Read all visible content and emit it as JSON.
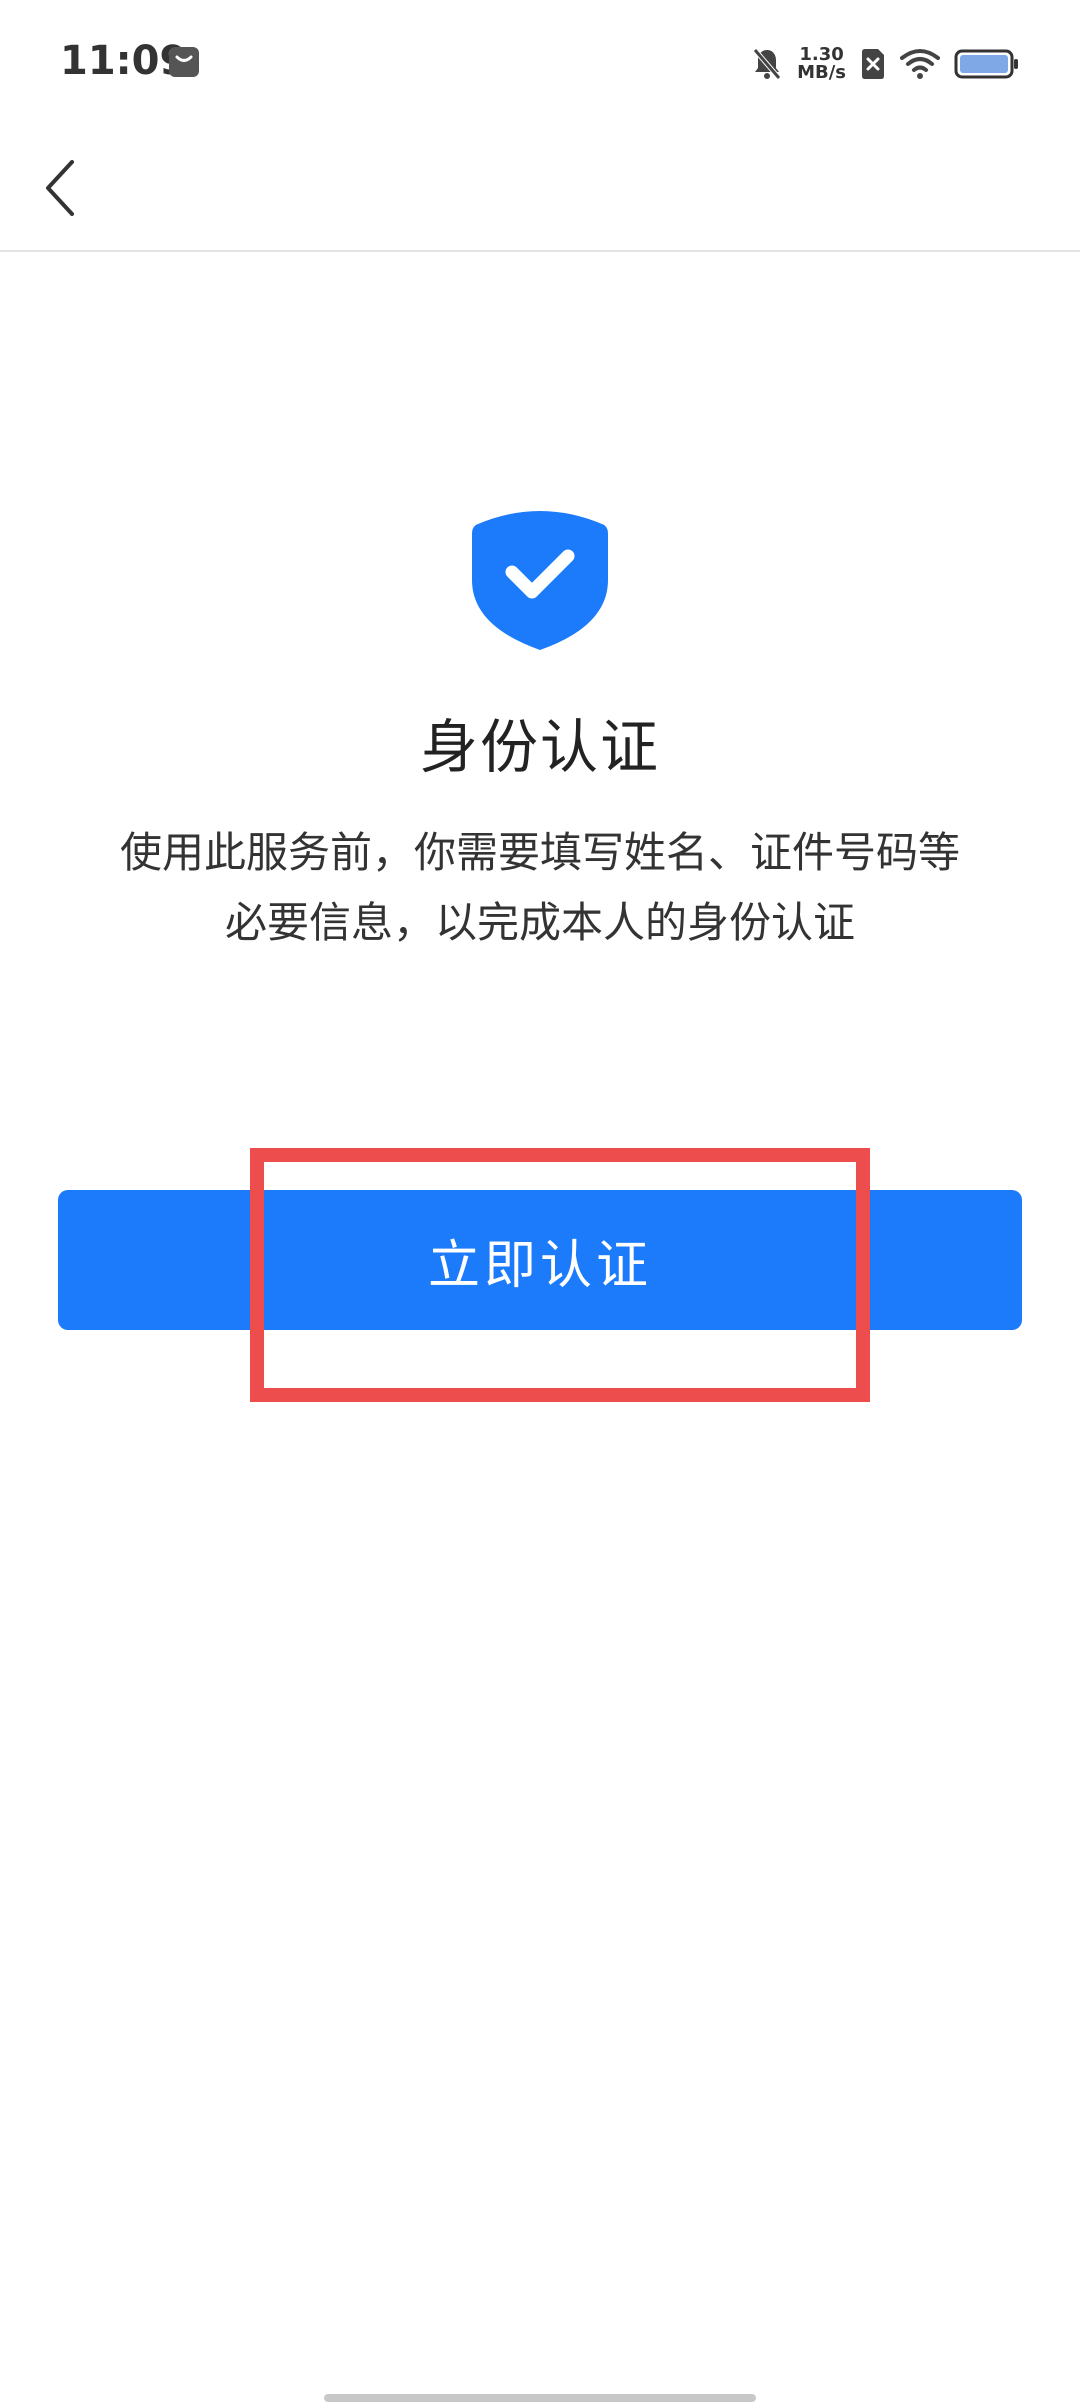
{
  "status_bar": {
    "time": "11:09",
    "net_speed_value": "1.30",
    "net_speed_unit": "MB/s"
  },
  "content": {
    "title": "身份认证",
    "desc_line1": "使用此服务前，你需要填写姓名、证件号码等",
    "desc_line2": "必要信息，以完成本人的身份认证"
  },
  "button": {
    "label": "立即认证"
  },
  "colors": {
    "accent": "#1b7bfb",
    "highlight": "#ee4d4d"
  },
  "icons": {
    "back": "chevron-left-icon",
    "shield": "shield-check-icon"
  }
}
